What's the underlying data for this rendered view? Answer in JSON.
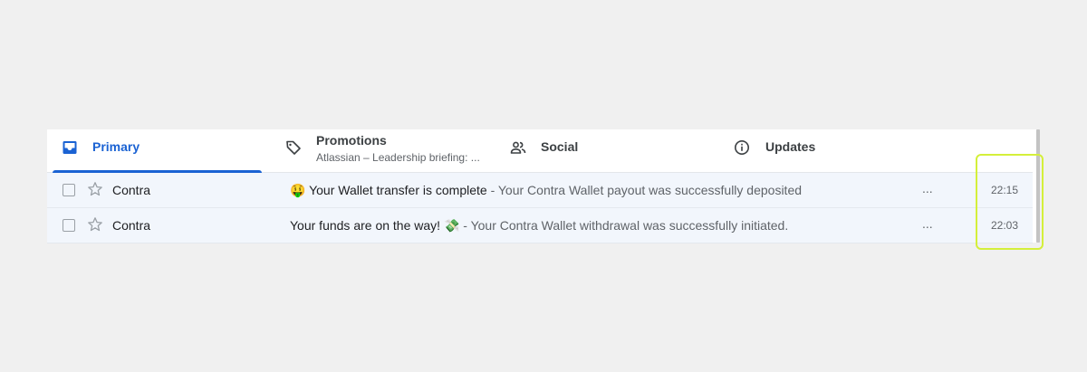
{
  "tabs": [
    {
      "label": "Primary",
      "icon": "inbox-icon",
      "active": true
    },
    {
      "label": "Promotions",
      "icon": "tag-icon",
      "sub": "Atlassian – Leadership briefing: ..."
    },
    {
      "label": "Social",
      "icon": "people-icon"
    },
    {
      "label": "Updates",
      "icon": "info-icon"
    }
  ],
  "emails": [
    {
      "sender": "Contra",
      "subject_emoji": "🤑",
      "subject": "Your Wallet transfer is complete",
      "snippet": " - Your Contra Wallet payout was successfully deposited",
      "more": "...",
      "time": "22:15"
    },
    {
      "sender": "Contra",
      "subject": "Your funds are on the way!",
      "subject_emoji": "💸",
      "snippet": " - Your Contra Wallet withdrawal was successfully initiated.",
      "more": "...",
      "time": "22:03"
    }
  ],
  "colors": {
    "accent": "#1a62d3",
    "row_bg": "#f2f6fc",
    "highlight": "#d4ef3a"
  }
}
